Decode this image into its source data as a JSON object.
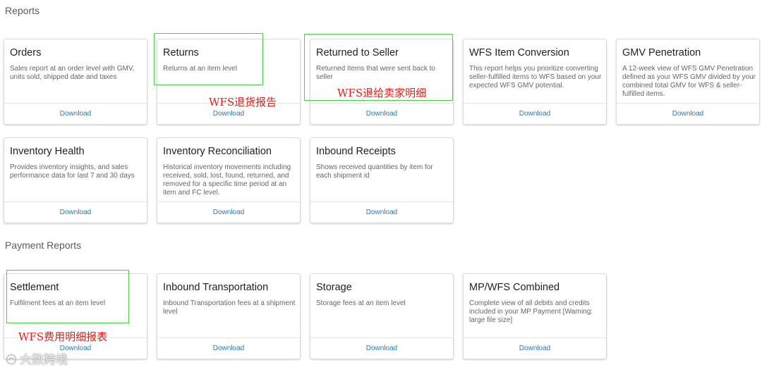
{
  "sections": {
    "reports": "Reports",
    "payment_reports": "Payment Reports"
  },
  "download_label": "Download",
  "cards": {
    "orders": {
      "title": "Orders",
      "desc": "Sales report at an order level with GMV, units sold, shipped date and taxes"
    },
    "returns": {
      "title": "Returns",
      "desc": "Returns at an item level"
    },
    "returned_to_seller": {
      "title": "Returned to Seller",
      "desc": "Returned Items that were sent back to seller"
    },
    "wfs_item_conversion": {
      "title": "WFS Item Conversion",
      "desc": "This report helps you prioritize converting seller-fulfilled items to WFS based on your expected WFS GMV potential."
    },
    "gmv_penetration": {
      "title": "GMV Penetration",
      "desc": "A 12-week view of WFS GMV Penetration defined as your WFS GMV divided by your combined total GMV for WFS & seller-fulfilled items."
    },
    "inventory_health": {
      "title": "Inventory Health",
      "desc": "Provides inventory insights, and sales performance data for last 7 and 30 days"
    },
    "inventory_reconciliation": {
      "title": "Inventory Reconciliation",
      "desc": "Historical inventory movements including received, sold, lost, found, returned, and removed for a specific time period at an item and FC level."
    },
    "inbound_receipts": {
      "title": "Inbound Receipts",
      "desc": "Shows received quantities by item for each shipment id"
    },
    "settlement": {
      "title": "Settlement",
      "desc": "Fulfilment fees at an item level"
    },
    "inbound_transportation": {
      "title": "Inbound Transportation",
      "desc": "Inbound Transportation fees at a shipment level"
    },
    "storage": {
      "title": "Storage",
      "desc": "Storage fees at an item level"
    },
    "mp_wfs_combined": {
      "title": "MP/WFS Combined",
      "desc": "Complete view of all debits and credits included in your MP Payment [Warning: large file size]"
    }
  },
  "annotations": {
    "returns": "WFS退货报告",
    "returned_to_seller": "WFS退给卖家明细",
    "settlement": "WFS费用明细报表"
  },
  "watermark": "大数跨境",
  "colors": {
    "link": "#2a77b8",
    "highlight": "#4bd04b",
    "annotation": "#e0201a"
  }
}
